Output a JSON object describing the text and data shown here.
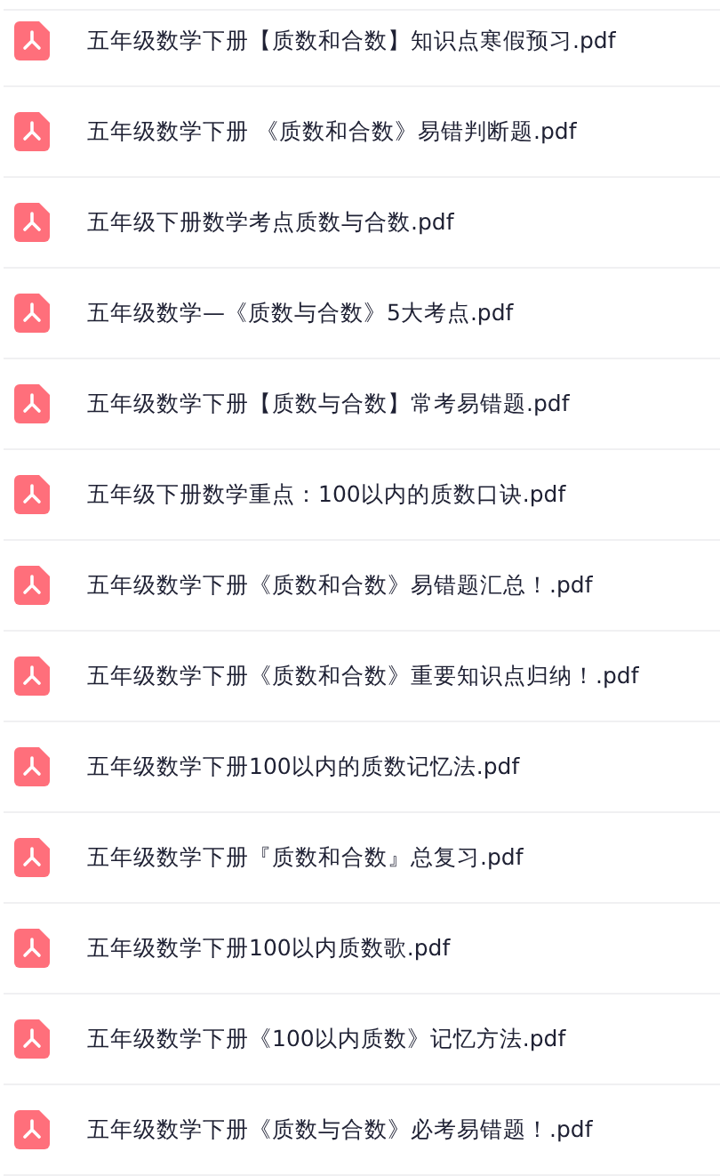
{
  "files": [
    {
      "name": "五年级数学下册【质数和合数】知识点寒假预习.pdf"
    },
    {
      "name": "五年级数学下册 《质数和合数》易错判断题.pdf"
    },
    {
      "name": "五年级下册数学考点质数与合数.pdf"
    },
    {
      "name": "五年级数学—《质数与合数》5大考点.pdf"
    },
    {
      "name": "五年级数学下册【质数与合数】常考易错题.pdf"
    },
    {
      "name": "五年级下册数学重点：100以内的质数口诀.pdf"
    },
    {
      "name": "五年级数学下册《质数和合数》易错题汇总！.pdf"
    },
    {
      "name": "五年级数学下册《质数和合数》重要知识点归纳！.pdf"
    },
    {
      "name": "五年级数学下册100以内的质数记忆法.pdf"
    },
    {
      "name": "五年级数学下册『质数和合数』总复习.pdf"
    },
    {
      "name": "五年级数学下册100以内质数歌.pdf"
    },
    {
      "name": "五年级数学下册《100以内质数》记忆方法.pdf"
    },
    {
      "name": "五年级数学下册《质数与合数》必考易错题！.pdf"
    }
  ]
}
